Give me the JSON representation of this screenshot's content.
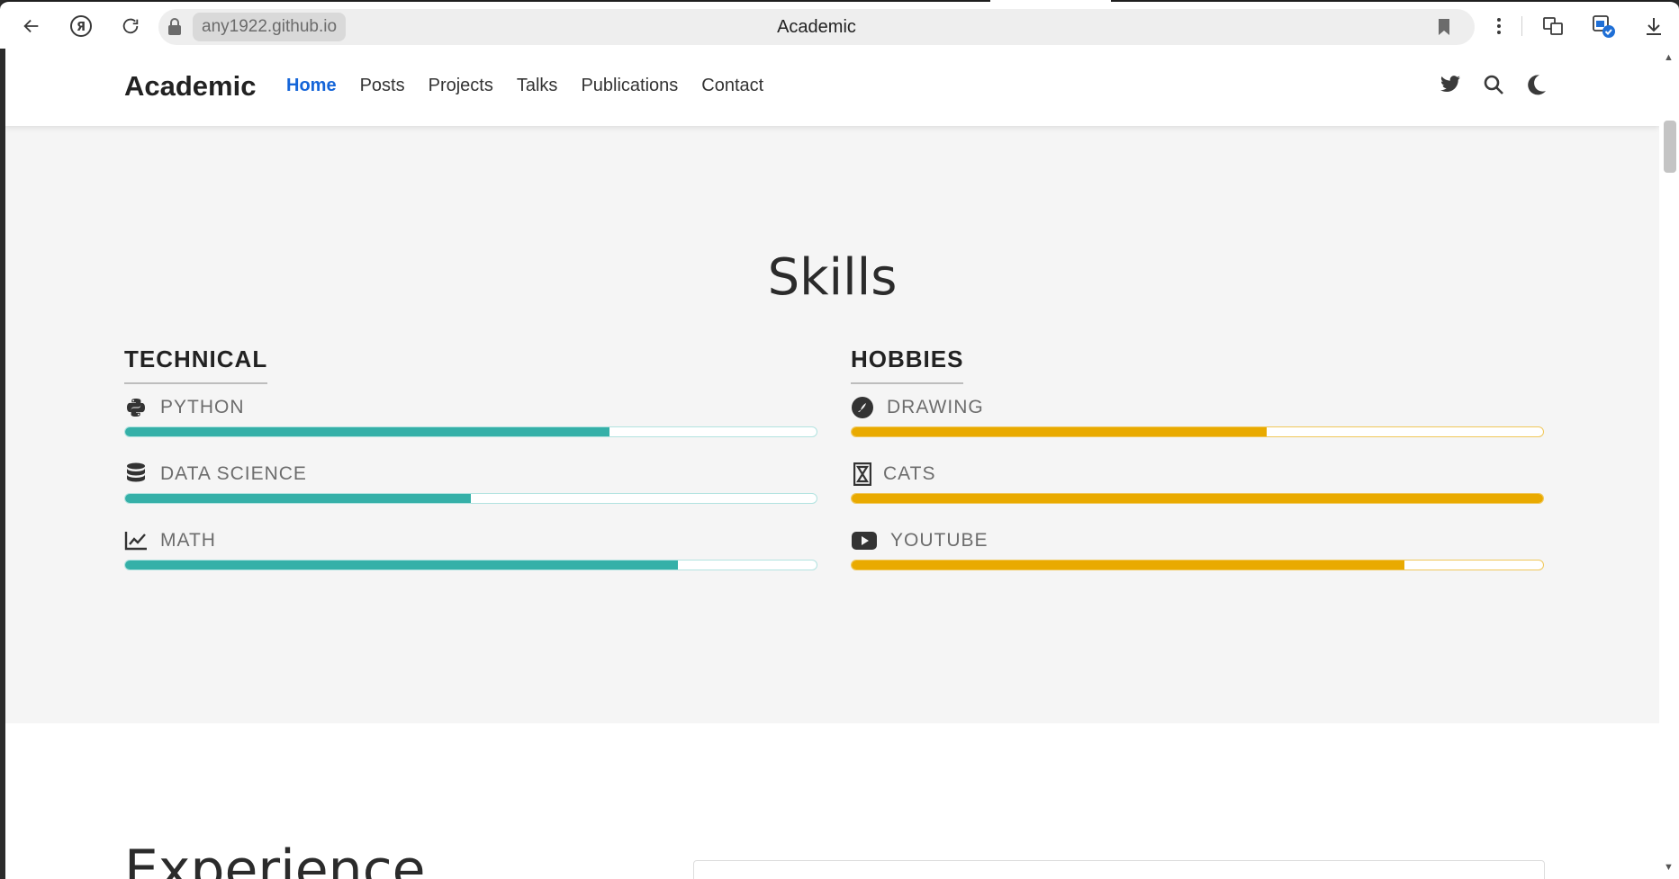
{
  "browser": {
    "url": "any1922.github.io",
    "tab_title": "Academic"
  },
  "navbar": {
    "brand": "Academic",
    "links": [
      "Home",
      "Posts",
      "Projects",
      "Talks",
      "Publications",
      "Contact"
    ],
    "active_link": "Home",
    "icons": [
      "twitter-icon",
      "search-icon",
      "moon-icon"
    ]
  },
  "skills": {
    "title": "Skills",
    "technical": {
      "heading": "TECHNICAL",
      "color": "#35b0a8",
      "items": [
        {
          "label": "PYTHON",
          "icon": "python-icon",
          "percent": 70
        },
        {
          "label": "DATA SCIENCE",
          "icon": "database-icon",
          "percent": 50
        },
        {
          "label": "MATH",
          "icon": "chart-line-icon",
          "percent": 80
        }
      ]
    },
    "hobbies": {
      "heading": "HOBBIES",
      "color": "#e9aa00",
      "items": [
        {
          "label": "DRAWING",
          "icon": "drawing-icon",
          "percent": 60
        },
        {
          "label": "CATS",
          "icon": "hourglass-icon",
          "percent": 100
        },
        {
          "label": "YOUTUBE",
          "icon": "youtube-icon",
          "percent": 80
        }
      ]
    }
  },
  "experience": {
    "title": "Experience"
  }
}
